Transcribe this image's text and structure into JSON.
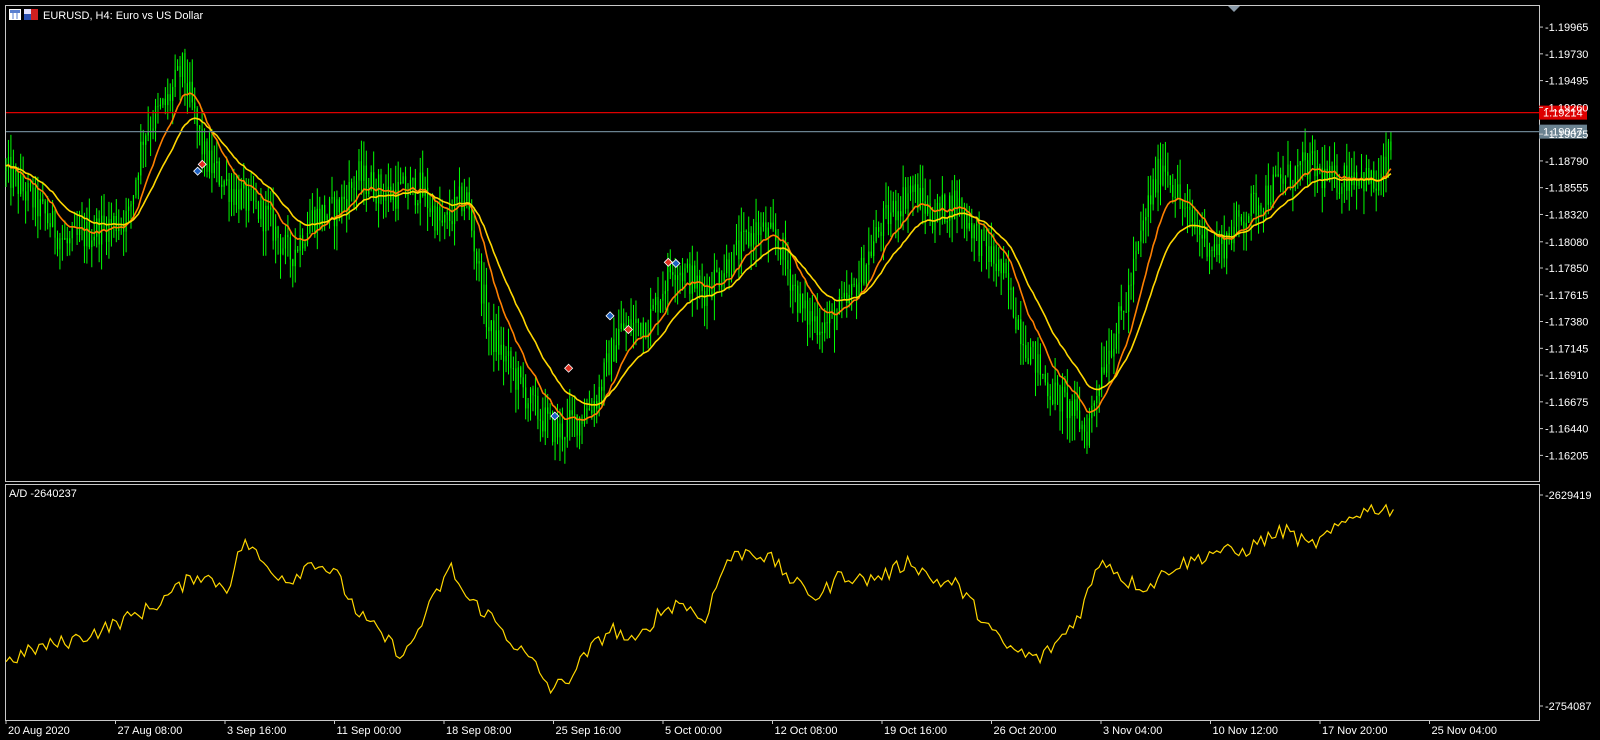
{
  "window": {
    "symbol_label": "EURUSD, H4:  Euro vs US Dollar",
    "indicator_label": "A/D -2640237"
  },
  "colors": {
    "background": "#000000",
    "frame": "#c8c8c8",
    "candles": "#00ff00",
    "ma_fast": "#ff8000",
    "ma_slow": "#ffd700",
    "ad_line": "#ffd700",
    "resistance": "#dd0000",
    "bid_line": "#6a8290",
    "buy_marker": "#1e60c0",
    "sell_marker": "#e03020"
  },
  "icons": [
    "chart-window-icon",
    "flag-icon",
    "shift-triangle-icon"
  ],
  "chart_data": [
    {
      "type": "candlestick",
      "title": "EURUSD, H4:  Euro vs US Dollar",
      "ylim": [
        1.1598,
        1.2015
      ],
      "y_ticks": [
        "1.19965",
        "1.19730",
        "1.19495",
        "1.19260",
        "1.19025",
        "1.18790",
        "1.18555",
        "1.18320",
        "1.18080",
        "1.17850",
        "1.17615",
        "1.17380",
        "1.17145",
        "1.16910",
        "1.16675",
        "1.16440",
        "1.16205"
      ],
      "x_ticks": [
        "20 Aug 2020",
        "27 Aug 08:00",
        "3 Sep 16:00",
        "11 Sep 00:00",
        "18 Sep 08:00",
        "25 Sep 16:00",
        "5 Oct 00:00",
        "12 Oct 08:00",
        "19 Oct 16:00",
        "26 Oct 20:00",
        "3 Nov 04:00",
        "10 Nov 12:00",
        "17 Nov 20:00",
        "25 Nov 04:00"
      ],
      "horizontal_lines": [
        {
          "label": "1.19214",
          "value": 1.19214,
          "color": "#dd0000"
        },
        {
          "label": "1.19047",
          "value": 1.19047,
          "color": "#6a8290"
        }
      ],
      "price_path": [
        [
          0.0,
          1.187
        ],
        [
          0.02,
          1.184
        ],
        [
          0.04,
          1.1805
        ],
        [
          0.06,
          1.182
        ],
        [
          0.08,
          1.183
        ],
        [
          0.09,
          1.1905
        ],
        [
          0.105,
          1.193
        ],
        [
          0.115,
          1.196
        ],
        [
          0.13,
          1.188
        ],
        [
          0.15,
          1.185
        ],
        [
          0.17,
          1.183
        ],
        [
          0.185,
          1.1795
        ],
        [
          0.2,
          1.183
        ],
        [
          0.215,
          1.1835
        ],
        [
          0.23,
          1.1865
        ],
        [
          0.25,
          1.185
        ],
        [
          0.27,
          1.1855
        ],
        [
          0.285,
          1.182
        ],
        [
          0.3,
          1.185
        ],
        [
          0.315,
          1.173
        ],
        [
          0.33,
          1.1695
        ],
        [
          0.345,
          1.166
        ],
        [
          0.36,
          1.164
        ],
        [
          0.375,
          1.1655
        ],
        [
          0.385,
          1.167
        ],
        [
          0.4,
          1.173
        ],
        [
          0.42,
          1.174
        ],
        [
          0.435,
          1.179
        ],
        [
          0.455,
          1.1765
        ],
        [
          0.475,
          1.1795
        ],
        [
          0.49,
          1.182
        ],
        [
          0.505,
          1.1805
        ],
        [
          0.52,
          1.1745
        ],
        [
          0.535,
          1.1735
        ],
        [
          0.55,
          1.1755
        ],
        [
          0.57,
          1.182
        ],
        [
          0.59,
          1.1855
        ],
        [
          0.605,
          1.183
        ],
        [
          0.62,
          1.1845
        ],
        [
          0.635,
          1.181
        ],
        [
          0.65,
          1.178
        ],
        [
          0.665,
          1.172
        ],
        [
          0.68,
          1.168
        ],
        [
          0.695,
          1.166
        ],
        [
          0.705,
          1.164
        ],
        [
          0.715,
          1.17
        ],
        [
          0.73,
          1.175
        ],
        [
          0.745,
          1.184
        ],
        [
          0.755,
          1.188
        ],
        [
          0.77,
          1.183
        ],
        [
          0.79,
          1.18
        ],
        [
          0.81,
          1.1835
        ],
        [
          0.83,
          1.186
        ],
        [
          0.85,
          1.1875
        ],
        [
          0.865,
          1.186
        ],
        [
          0.88,
          1.187
        ],
        [
          0.895,
          1.1855
        ],
        [
          0.905,
          1.1895
        ]
      ],
      "markers": [
        {
          "kind": "buy",
          "time": 0.125,
          "price": 1.187
        },
        {
          "kind": "sell",
          "time": 0.128,
          "price": 1.1876
        },
        {
          "kind": "buy",
          "time": 0.358,
          "price": 1.1655
        },
        {
          "kind": "sell",
          "time": 0.367,
          "price": 1.1697
        },
        {
          "kind": "buy",
          "time": 0.394,
          "price": 1.1743
        },
        {
          "kind": "sell",
          "time": 0.406,
          "price": 1.1731
        },
        {
          "kind": "sell",
          "time": 0.432,
          "price": 1.179
        },
        {
          "kind": "buy",
          "time": 0.437,
          "price": 1.1789
        }
      ]
    },
    {
      "type": "line",
      "title": "A/D -2640237",
      "ylim": [
        -2754087,
        -2629419
      ],
      "y_ticks": [
        "-2629419",
        "-2754087"
      ],
      "series": [
        {
          "color": "#ffd700",
          "values": [
            [
              0.0,
              -2728000
            ],
            [
              0.02,
              -2720000
            ],
            [
              0.04,
              -2716000
            ],
            [
              0.06,
              -2710000
            ],
            [
              0.08,
              -2702000
            ],
            [
              0.095,
              -2696000
            ],
            [
              0.11,
              -2686000
            ],
            [
              0.125,
              -2676000
            ],
            [
              0.145,
              -2684000
            ],
            [
              0.155,
              -2656000
            ],
            [
              0.17,
              -2672000
            ],
            [
              0.185,
              -2680000
            ],
            [
              0.2,
              -2668000
            ],
            [
              0.215,
              -2676000
            ],
            [
              0.23,
              -2700000
            ],
            [
              0.245,
              -2712000
            ],
            [
              0.26,
              -2725000
            ],
            [
              0.275,
              -2698000
            ],
            [
              0.29,
              -2672000
            ],
            [
              0.3,
              -2690000
            ],
            [
              0.315,
              -2700000
            ],
            [
              0.33,
              -2716000
            ],
            [
              0.345,
              -2730000
            ],
            [
              0.355,
              -2744000
            ],
            [
              0.365,
              -2740000
            ],
            [
              0.38,
              -2722000
            ],
            [
              0.395,
              -2708000
            ],
            [
              0.41,
              -2718000
            ],
            [
              0.425,
              -2700000
            ],
            [
              0.44,
              -2692000
            ],
            [
              0.455,
              -2704000
            ],
            [
              0.47,
              -2668000
            ],
            [
              0.485,
              -2662000
            ],
            [
              0.5,
              -2668000
            ],
            [
              0.515,
              -2682000
            ],
            [
              0.53,
              -2690000
            ],
            [
              0.545,
              -2676000
            ],
            [
              0.56,
              -2680000
            ],
            [
              0.575,
              -2676000
            ],
            [
              0.59,
              -2668000
            ],
            [
              0.605,
              -2680000
            ],
            [
              0.62,
              -2682000
            ],
            [
              0.635,
              -2700000
            ],
            [
              0.65,
              -2718000
            ],
            [
              0.665,
              -2724000
            ],
            [
              0.675,
              -2726000
            ],
            [
              0.69,
              -2712000
            ],
            [
              0.7,
              -2700000
            ],
            [
              0.715,
              -2666000
            ],
            [
              0.73,
              -2680000
            ],
            [
              0.745,
              -2684000
            ],
            [
              0.76,
              -2672000
            ],
            [
              0.775,
              -2668000
            ],
            [
              0.79,
              -2662000
            ],
            [
              0.805,
              -2664000
            ],
            [
              0.82,
              -2656000
            ],
            [
              0.835,
              -2650000
            ],
            [
              0.85,
              -2660000
            ],
            [
              0.865,
              -2652000
            ],
            [
              0.88,
              -2640000
            ],
            [
              0.895,
              -2637000
            ],
            [
              0.905,
              -2638000
            ]
          ]
        }
      ]
    }
  ]
}
